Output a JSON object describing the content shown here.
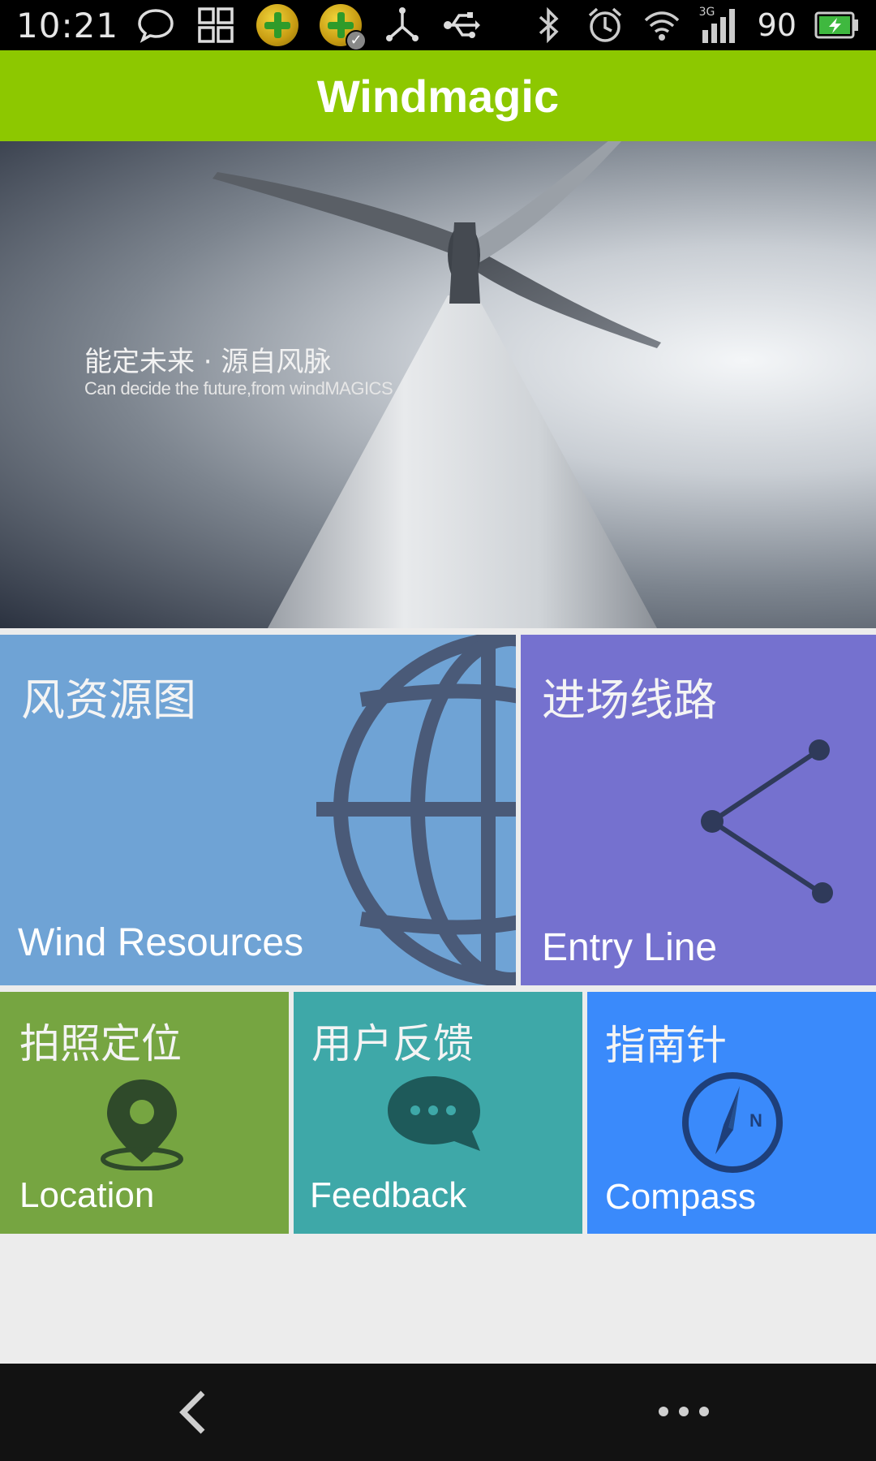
{
  "status_bar": {
    "time": "10:21",
    "battery_level": "90",
    "network_type": "3G",
    "icons_left": [
      "chat-bubble-icon",
      "grid-icon",
      "app-badge-icon",
      "app-badge-check-icon",
      "usb-debug-icon",
      "usb-icon"
    ],
    "icons_right": [
      "bluetooth-icon",
      "alarm-icon",
      "wifi-icon",
      "signal-icon",
      "battery-charging-icon"
    ]
  },
  "app_bar": {
    "title": "Windmagic",
    "color": "#8dc800"
  },
  "hero": {
    "slogan_cn": "能定未来 · 源自风脉",
    "slogan_en": "Can decide the future,from windMAGICS"
  },
  "tiles": {
    "wind_resources": {
      "cn": "风资源图",
      "en": "Wind Resources",
      "icon": "globe-icon",
      "color": "#6fa3d5"
    },
    "entry_line": {
      "cn": "进场线路",
      "en": "Entry Line",
      "icon": "share-icon",
      "color": "#7571cf"
    },
    "location": {
      "cn": "拍照定位",
      "en": "Location",
      "icon": "map-pin-icon",
      "color": "#76a541"
    },
    "feedback": {
      "cn": "用户反馈",
      "en": "Feedback",
      "icon": "chat-icon",
      "color": "#3ea8a8"
    },
    "compass": {
      "cn": "指南针",
      "en": "Compass",
      "icon": "compass-icon",
      "color": "#3a8afb",
      "icon_letter": "N"
    }
  },
  "nav_bar": {
    "back_icon": "back-chevron-icon",
    "more_icon": "more-dots-icon"
  }
}
